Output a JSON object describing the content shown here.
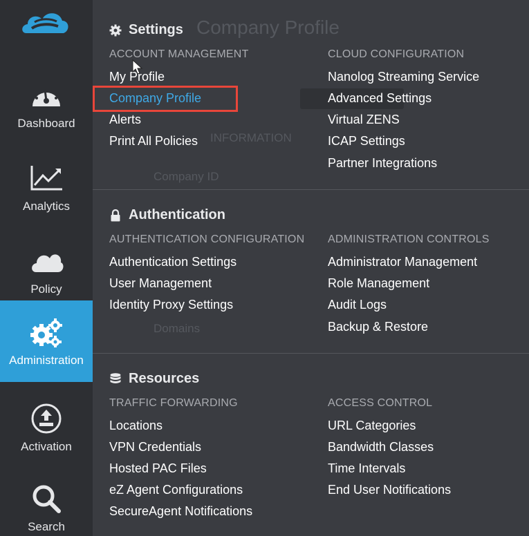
{
  "sidebar": {
    "logo_icon": "cloud-logo",
    "items": [
      {
        "label": "Dashboard",
        "icon": "speedometer-icon"
      },
      {
        "label": "Analytics",
        "icon": "line-chart-icon"
      },
      {
        "label": "Policy",
        "icon": "cloud-icon"
      },
      {
        "label": "Administration",
        "icon": "gears-icon"
      },
      {
        "label": "Activation",
        "icon": "upload-icon"
      },
      {
        "label": "Search",
        "icon": "search-icon"
      }
    ],
    "active_item": "Administration",
    "active_color": "#2f9fd8"
  },
  "background_page": {
    "title": "Company Profile",
    "texts": [
      "INFORMATION",
      "Company ID",
      "Domains"
    ]
  },
  "menu": {
    "sections": [
      {
        "title": "Settings",
        "icon": "gear-icon",
        "columns": [
          {
            "title": "ACCOUNT MANAGEMENT",
            "items": [
              "My Profile",
              "Company Profile",
              "Alerts",
              "Print All Policies"
            ]
          },
          {
            "title": "CLOUD CONFIGURATION",
            "items": [
              "Nanolog Streaming Service",
              "Advanced Settings",
              "Virtual ZENS",
              "ICAP Settings",
              "Partner Integrations"
            ]
          }
        ]
      },
      {
        "title": "Authentication",
        "icon": "lock-icon",
        "columns": [
          {
            "title": "AUTHENTICATION CONFIGURATION",
            "items": [
              "Authentication Settings",
              "User Management",
              "Identity Proxy Settings"
            ]
          },
          {
            "title": "ADMINISTRATION CONTROLS",
            "items": [
              "Administrator Management",
              "Role Management",
              "Audit Logs",
              "Backup & Restore"
            ]
          }
        ]
      },
      {
        "title": "Resources",
        "icon": "database-icon",
        "columns": [
          {
            "title": "TRAFFIC FORWARDING",
            "items": [
              "Locations",
              "VPN Credentials",
              "Hosted PAC Files",
              "eZ Agent Configurations",
              "SecureAgent Notifications"
            ]
          },
          {
            "title": "ACCESS CONTROL",
            "items": [
              "URL Categories",
              "Bandwidth Classes",
              "Time Intervals",
              "End User Notifications"
            ]
          }
        ]
      }
    ],
    "selected_item": "Company Profile",
    "link_color": "#3fa9e6",
    "highlight_color": "#e8463a"
  }
}
